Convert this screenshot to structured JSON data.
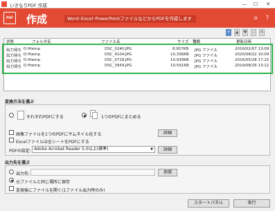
{
  "window": {
    "title": "いきなりPDF  作成",
    "minimize": "—",
    "maximize": "☐",
    "close": "✕"
  },
  "header": {
    "logo_text": "PDF",
    "heading": "作成",
    "subtitle": "Word･Excel･PowerPointファイルなどからPDFを作成します",
    "home_icon": "⌂",
    "help_icon": "?"
  },
  "toolbar": {
    "add": "+",
    "up": "▲",
    "down": "▼",
    "remove": "−",
    "clear": "✕"
  },
  "file_list": {
    "columns": [
      "状態",
      "フォルダ名",
      "ファイル名",
      "サイズ",
      "種類",
      "更新日時"
    ],
    "rows": [
      [
        "出力待ち",
        "D:¥temp",
        "DSC_0240.JPG",
        "8,957KB",
        "JPG ファイル",
        "2016/02/07 13:09"
      ],
      [
        "出力待ち",
        "D:¥temp",
        "DSC_4104.JPG",
        "10,336KB",
        "JPG ファイル",
        "2020/08/22 10:09"
      ],
      [
        "出力待ち",
        "D:¥temp",
        "DSC_0718.JPG",
        "10,939KB",
        "JPG ファイル",
        "2016/05/28 17:15"
      ],
      [
        "出力待ち",
        "D:¥temp",
        "DSC_3959.JPG",
        "10,591KB",
        "JPG ファイル",
        "2019/08/26 13:12"
      ]
    ]
  },
  "conversion": {
    "section_label": "変換方法を選ぶ",
    "option_separate": "それぞれPDFにする",
    "option_combine": "1つのPDFにまとめる",
    "thumbnail_label": "画像ファイルを1つのPDFにサムネイル化する",
    "excel_label": "Excelファイルは全シートをPDFにする",
    "details_button": "詳細",
    "pdf_settings_label": "PDFの設定:",
    "pdf_settings_value": "Adobe Acrobat Reader 5.0以上(標準)",
    "details_button_2": "詳細"
  },
  "output": {
    "section_label": "出力先を選ぶ",
    "dest_label": "出力先:",
    "dest_value": "",
    "browse_button": "参照",
    "same_location_label": "元ファイルと同じ場所に保存",
    "open_after_label": "変換後にファイルを開く(1ファイル出力時のみ)"
  },
  "footer": {
    "start_panel_button": "スタートパネル",
    "run_button": "実行"
  }
}
